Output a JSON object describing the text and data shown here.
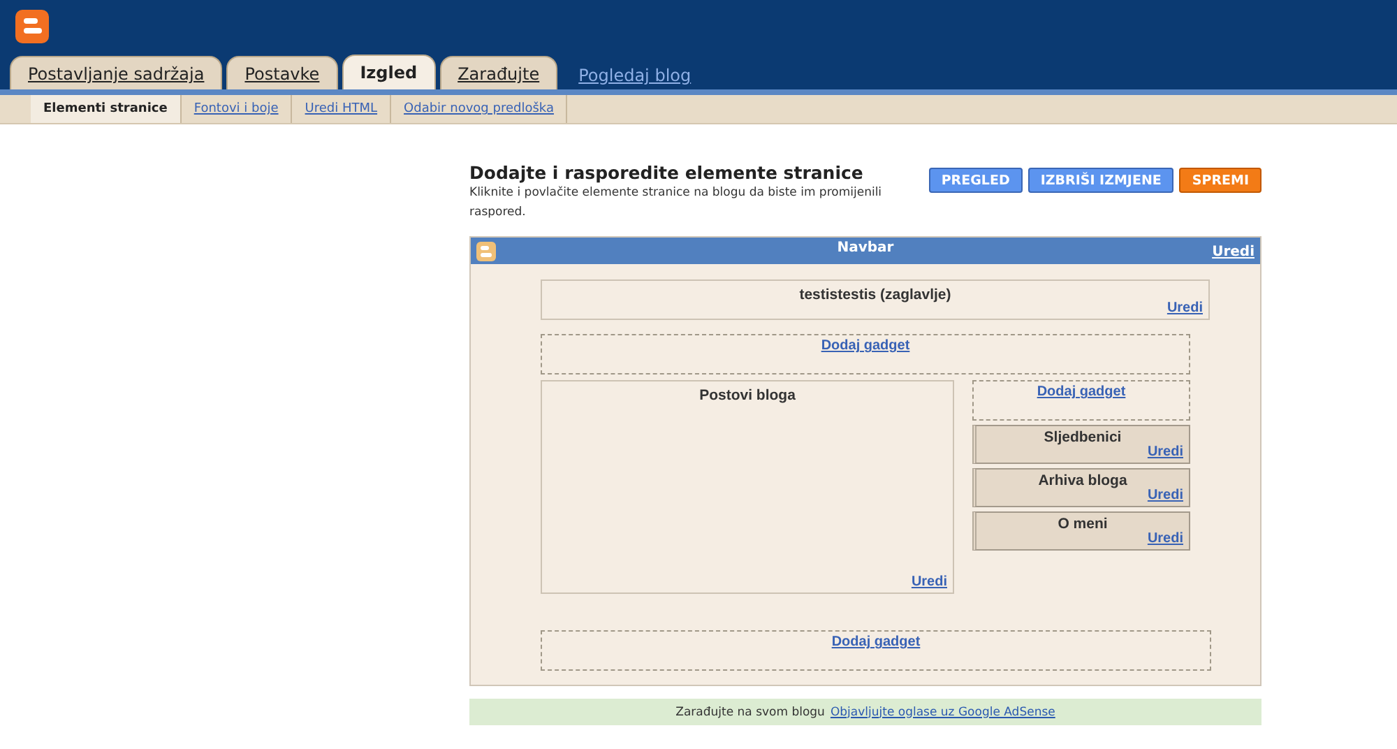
{
  "tabs": [
    {
      "label": "Postavljanje sadržaja",
      "selected": false
    },
    {
      "label": "Postavke",
      "selected": false
    },
    {
      "label": "Izgled",
      "selected": true
    },
    {
      "label": "Zarađujte",
      "selected": false
    }
  ],
  "view_blog": "Pogledaj blog",
  "subtabs": [
    {
      "label": "Elementi stranice",
      "selected": true
    },
    {
      "label": "Fontovi i boje",
      "selected": false
    },
    {
      "label": "Uredi HTML",
      "selected": false
    },
    {
      "label": "Odabir novog predloška",
      "selected": false
    }
  ],
  "page": {
    "title": "Dodajte i rasporedite elemente stranice",
    "description": "Kliknite i povlačite elemente stranice na blogu da biste im promijenili raspored."
  },
  "buttons": [
    {
      "label": "PREGLED",
      "kind": "action"
    },
    {
      "label": "IZBRIŠI IZMJENE",
      "kind": "action"
    },
    {
      "label": "SPREMI",
      "kind": "save"
    }
  ],
  "layout": {
    "navbar": {
      "title": "Navbar",
      "edit": "Uredi"
    },
    "header_gadget": {
      "title": "testistestis (zaglavlje)",
      "edit": "Uredi"
    },
    "add_gadget_top": "Dodaj gadget",
    "main": {
      "title": "Postovi bloga",
      "edit": "Uredi"
    },
    "sidebar_add_gadget": "Dodaj gadget",
    "sidebar": [
      {
        "title": "Sljedbenici",
        "edit": "Uredi"
      },
      {
        "title": "Arhiva bloga",
        "edit": "Uredi"
      },
      {
        "title": "O meni",
        "edit": "Uredi"
      }
    ],
    "add_gadget_bottom": "Dodaj gadget"
  },
  "adsense": {
    "text": "Zarađujte na svom blogu",
    "link": "Objavljujte oglase uz Google AdSense"
  }
}
